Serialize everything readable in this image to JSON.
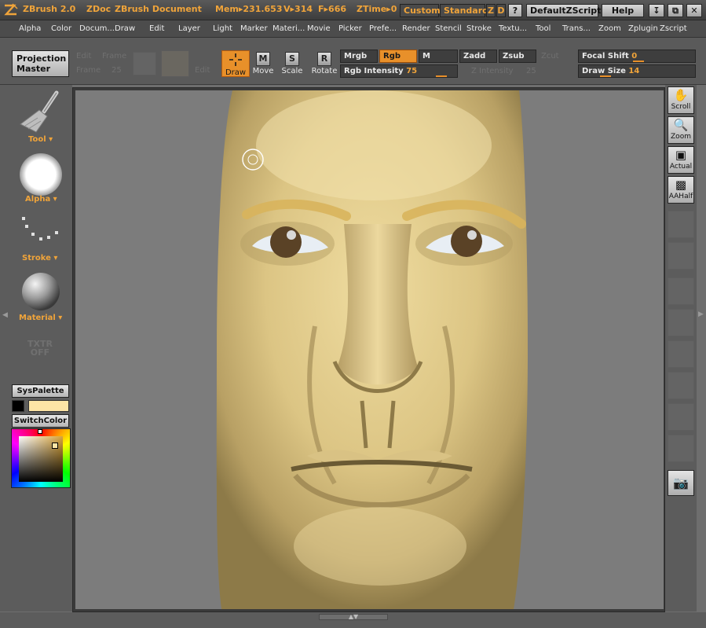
{
  "app": {
    "name": "ZBrush 2.0",
    "doc_label": "ZDoc",
    "doc_title": "ZBrush Document",
    "mem": "Mem▸231.653",
    "vertices": "V▸314",
    "faces": "F▸666",
    "ztime": "ZTime▸0",
    "custom_label": "Custom",
    "standard_label": "Standard",
    "z_label": "Z",
    "d_label": "D",
    "help_question": "?",
    "script_label": "DefaultZScript",
    "help_label": "Help"
  },
  "menu": [
    "Alpha",
    "Color",
    "Docum...",
    "Draw",
    "Edit",
    "Layer",
    "Light",
    "Marker",
    "Materi...",
    "Movie",
    "Picker",
    "Prefe...",
    "Render",
    "Stencil",
    "Stroke",
    "Textu...",
    "Tool",
    "Trans...",
    "Zoom",
    "Zplugin",
    "Zscript"
  ],
  "toolbar": {
    "projection_master": "Projection Master",
    "faint_labels": [
      "Edit",
      "Frame",
      "Frame",
      "25",
      "Edit"
    ],
    "tools": [
      "Draw",
      "Move",
      "Scale",
      "Rotate"
    ],
    "tool_glyphs": [
      "M",
      "S",
      "R"
    ],
    "mrgb": "Mrgb",
    "rgb": "Rgb",
    "m": "M",
    "zadd": "Zadd",
    "zsub": "Zsub",
    "zcut": "Zcut",
    "rgb_intensity_label": "Rgb Intensity",
    "rgb_intensity_value": "75",
    "z_intensity_label": "Z Intensity",
    "z_intensity_value": "25",
    "focal_shift_label": "Focal Shift",
    "focal_shift_value": "0",
    "draw_size_label": "Draw Size",
    "draw_size_value": "14"
  },
  "left_tray": {
    "tool": "Tool",
    "alpha": "Alpha",
    "stroke": "Stroke",
    "material": "Material",
    "texture_off": "TXTR OFF",
    "syspalette": "SysPalette",
    "switchcolor": "SwitchColor",
    "primary_color": "#fde5a6",
    "secondary_color": "#000000"
  },
  "right_tray": {
    "scroll": "Scroll",
    "zoom": "Zoom",
    "actual": "Actual",
    "aahalf": "AAHalf"
  },
  "icons": [
    "zbrush-logo-icon",
    "minimize-icon",
    "restore-icon",
    "close-icon",
    "draw-crosshair-icon",
    "brush-tool-icon",
    "alpha-circle-icon",
    "stroke-dots-icon",
    "material-sphere-icon",
    "hand-scroll-icon",
    "zoom-magnifier-icon",
    "camera-icon"
  ]
}
